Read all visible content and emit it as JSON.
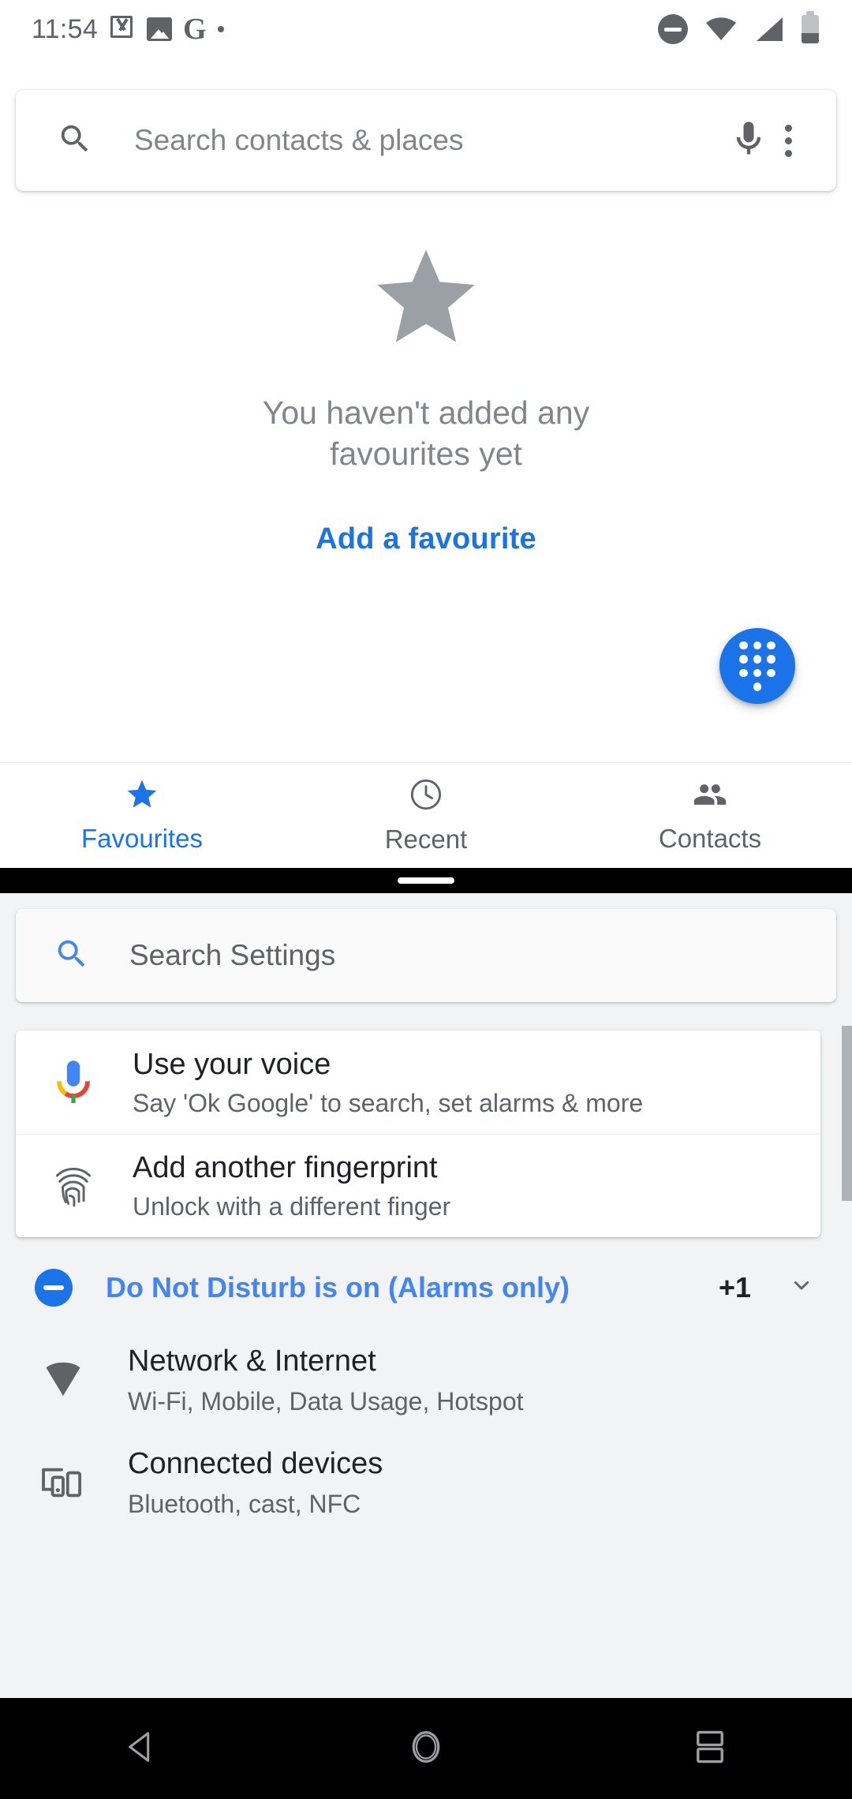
{
  "status_bar": {
    "time": "11:54",
    "left_icons": [
      "gmail-icon",
      "photos-icon",
      "google-g-icon",
      "dot-icon"
    ],
    "right_icons": [
      "do-not-disturb-icon",
      "wifi-icon",
      "cellular-signal-icon",
      "battery-icon"
    ]
  },
  "phone_app": {
    "search": {
      "placeholder": "Search contacts & places",
      "search_icon": "search-icon",
      "mic_icon": "microphone-icon",
      "overflow_icon": "more-options-icon"
    },
    "empty_state": {
      "icon": "star-icon",
      "message": "You haven't added any favourites yet",
      "action_label": "Add a favourite"
    },
    "fab": {
      "icon": "dialpad-icon",
      "color": "#1a73e8"
    },
    "tabs": [
      {
        "label": "Favourites",
        "icon": "star-icon",
        "active": true
      },
      {
        "label": "Recent",
        "icon": "clock-icon",
        "active": false
      },
      {
        "label": "Contacts",
        "icon": "people-icon",
        "active": false
      }
    ],
    "accent_color": "#1a73e8"
  },
  "settings_app": {
    "search": {
      "placeholder": "Search Settings",
      "search_icon": "search-icon",
      "icon_color": "#4285f4"
    },
    "suggestions": [
      {
        "icon": "google-assistant-mic-icon",
        "title": "Use your voice",
        "subtitle": "Say 'Ok Google' to search, set alarms & more"
      },
      {
        "icon": "fingerprint-icon",
        "title": "Add another fingerprint",
        "subtitle": "Unlock with a different finger"
      }
    ],
    "notice": {
      "icon": "do-not-disturb-icon",
      "label": "Do Not Disturb is on (Alarms only)",
      "count": "+1",
      "expand_icon": "chevron-down-icon",
      "color": "#4285f4"
    },
    "items": [
      {
        "icon": "wifi-icon",
        "title": "Network & Internet",
        "subtitle": "Wi-Fi, Mobile, Data Usage, Hotspot"
      },
      {
        "icon": "connected-devices-icon",
        "title": "Connected devices",
        "subtitle": "Bluetooth, cast, NFC"
      }
    ]
  },
  "nav_bar": {
    "back_icon": "back-triangle-icon",
    "home_icon": "home-circle-icon",
    "recents_icon": "split-screen-recents-icon"
  }
}
